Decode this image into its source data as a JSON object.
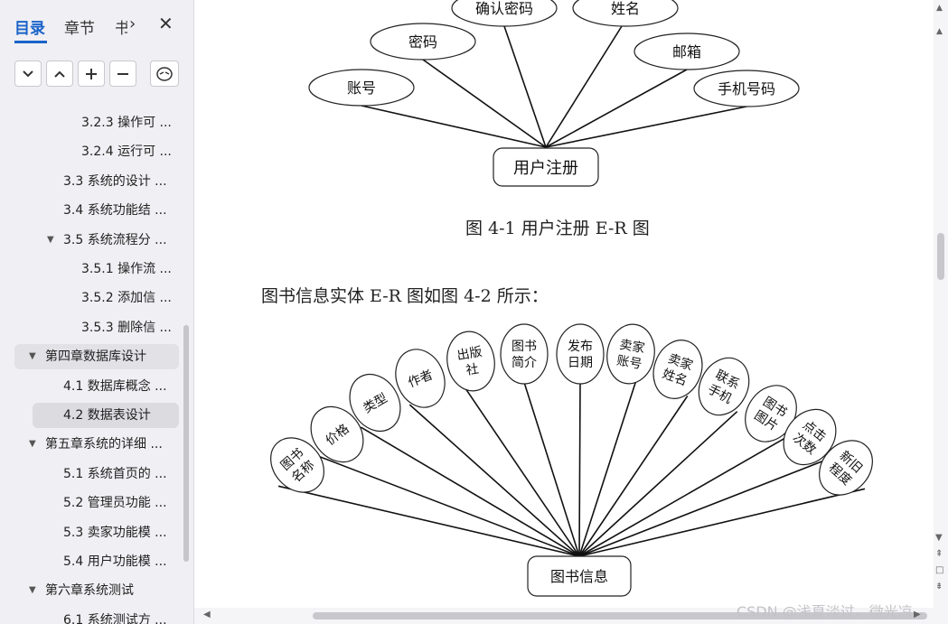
{
  "sidebar": {
    "tabs": [
      {
        "label": "目录",
        "active": true
      },
      {
        "label": "章节",
        "active": false
      },
      {
        "label": "书",
        "active": false
      }
    ],
    "toolbar_icons": [
      "chevron-down-icon",
      "chevron-up-icon",
      "plus-icon",
      "minus-icon",
      "settings-icon"
    ],
    "toc": [
      {
        "label": "3.2.3 操作可 ...",
        "level": 3
      },
      {
        "label": "3.2.4 运行可 ...",
        "level": 3
      },
      {
        "label": "3.3 系统的设计 ...",
        "level": 2
      },
      {
        "label": "3.4 系统功能结 ...",
        "level": 2
      },
      {
        "label": "3.5 系统流程分 ...",
        "level": 2,
        "expanded": true
      },
      {
        "label": "3.5.1 操作流 ...",
        "level": 3
      },
      {
        "label": "3.5.2 添加信 ...",
        "level": 3
      },
      {
        "label": "3.5.3 删除信 ...",
        "level": 3
      },
      {
        "label": "第四章数据库设计",
        "level": 1,
        "expanded": true,
        "state": "hover"
      },
      {
        "label": "4.1 数据库概念 ...",
        "level": 2
      },
      {
        "label": "4.2 数据表设计",
        "level": 2,
        "state": "selected"
      },
      {
        "label": "第五章系统的详细 ...",
        "level": 1,
        "expanded": true
      },
      {
        "label": "5.1 系统首页的 ...",
        "level": 2
      },
      {
        "label": "5.2 管理员功能 ...",
        "level": 2
      },
      {
        "label": "5.3 卖家功能模 ...",
        "level": 2
      },
      {
        "label": "5.4 用户功能模 ...",
        "level": 2
      },
      {
        "label": "第六章系统测试",
        "level": 1,
        "expanded": true
      },
      {
        "label": "6.1 系统测试方 ...",
        "level": 2
      }
    ]
  },
  "document": {
    "diagram1": {
      "entity": "用户注册",
      "attributes": [
        "账号",
        "密码",
        "确认密码",
        "姓名",
        "邮箱",
        "手机号码"
      ]
    },
    "caption1": "图 4-1 用户注册 E-R 图",
    "paragraph": "图书信息实体 E-R 图如图 4-2 所示：",
    "diagram2": {
      "entity": "图书信息",
      "attributes": [
        "图书名称",
        "价格",
        "类型",
        "作者",
        "出版社",
        "图书简介",
        "发布日期",
        "卖家账号",
        "卖家姓名",
        "联系手机",
        "图书图片",
        "点击次数",
        "新旧程度"
      ]
    }
  },
  "watermark": "CSDN @浅夏淡过，微光凉"
}
